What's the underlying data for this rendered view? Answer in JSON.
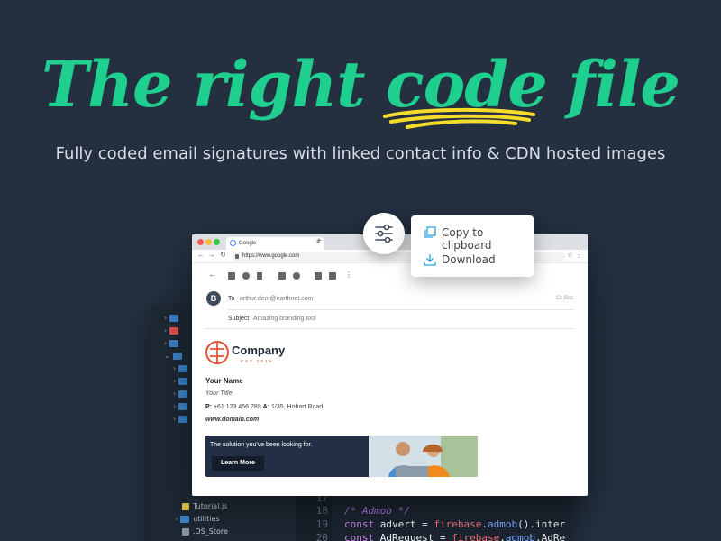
{
  "hero": {
    "title_pre": "The right ",
    "title_code": "code",
    "title_post": " file",
    "subtitle": "Fully coded email signatures with linked contact info & CDN hosted images"
  },
  "colors": {
    "background": "#243040",
    "accent": "#1fcf8f",
    "squiggle": "#f5dc2a"
  },
  "popup_menu": {
    "items": [
      {
        "label": "Copy to clipboard",
        "icon": "copy-icon"
      },
      {
        "label": "Download",
        "icon": "download-icon"
      }
    ]
  },
  "browser": {
    "tab_title": "Google",
    "url": "https://www.google.com"
  },
  "email": {
    "avatar_initial": "B",
    "to_label": "To",
    "to_value": "arthur.dent@earthnet.com",
    "cc_bcc": "Cc  Bcc",
    "subject_label": "Subject",
    "subject_value": "Amazing branding tool"
  },
  "signature": {
    "company": "Company",
    "established": "EST 2019",
    "name": "Your Name",
    "title": "Your Title",
    "phone_label": "P:",
    "phone": "+61 123 456 789",
    "address_label": "A:",
    "address": "1/35, Hobart Road",
    "domain": "www.domain.com",
    "banner_text": "The solution you've been looking for.",
    "banner_button": "Learn More"
  },
  "editor": {
    "files": [
      "Tutorial.js",
      "utilities",
      ".DS_Store"
    ],
    "line_numbers": [
      "17",
      "18",
      "19",
      "20"
    ],
    "comment": "/* Admob */",
    "line19": {
      "kw": "const",
      "var": "advert",
      "obj": "firebase",
      "method": "admob",
      "rest": "().interst"
    },
    "line20": {
      "kw": "const",
      "var": "AdRequest",
      "obj": "firebase",
      "method": "admob",
      "rest": ".AdReque"
    }
  }
}
